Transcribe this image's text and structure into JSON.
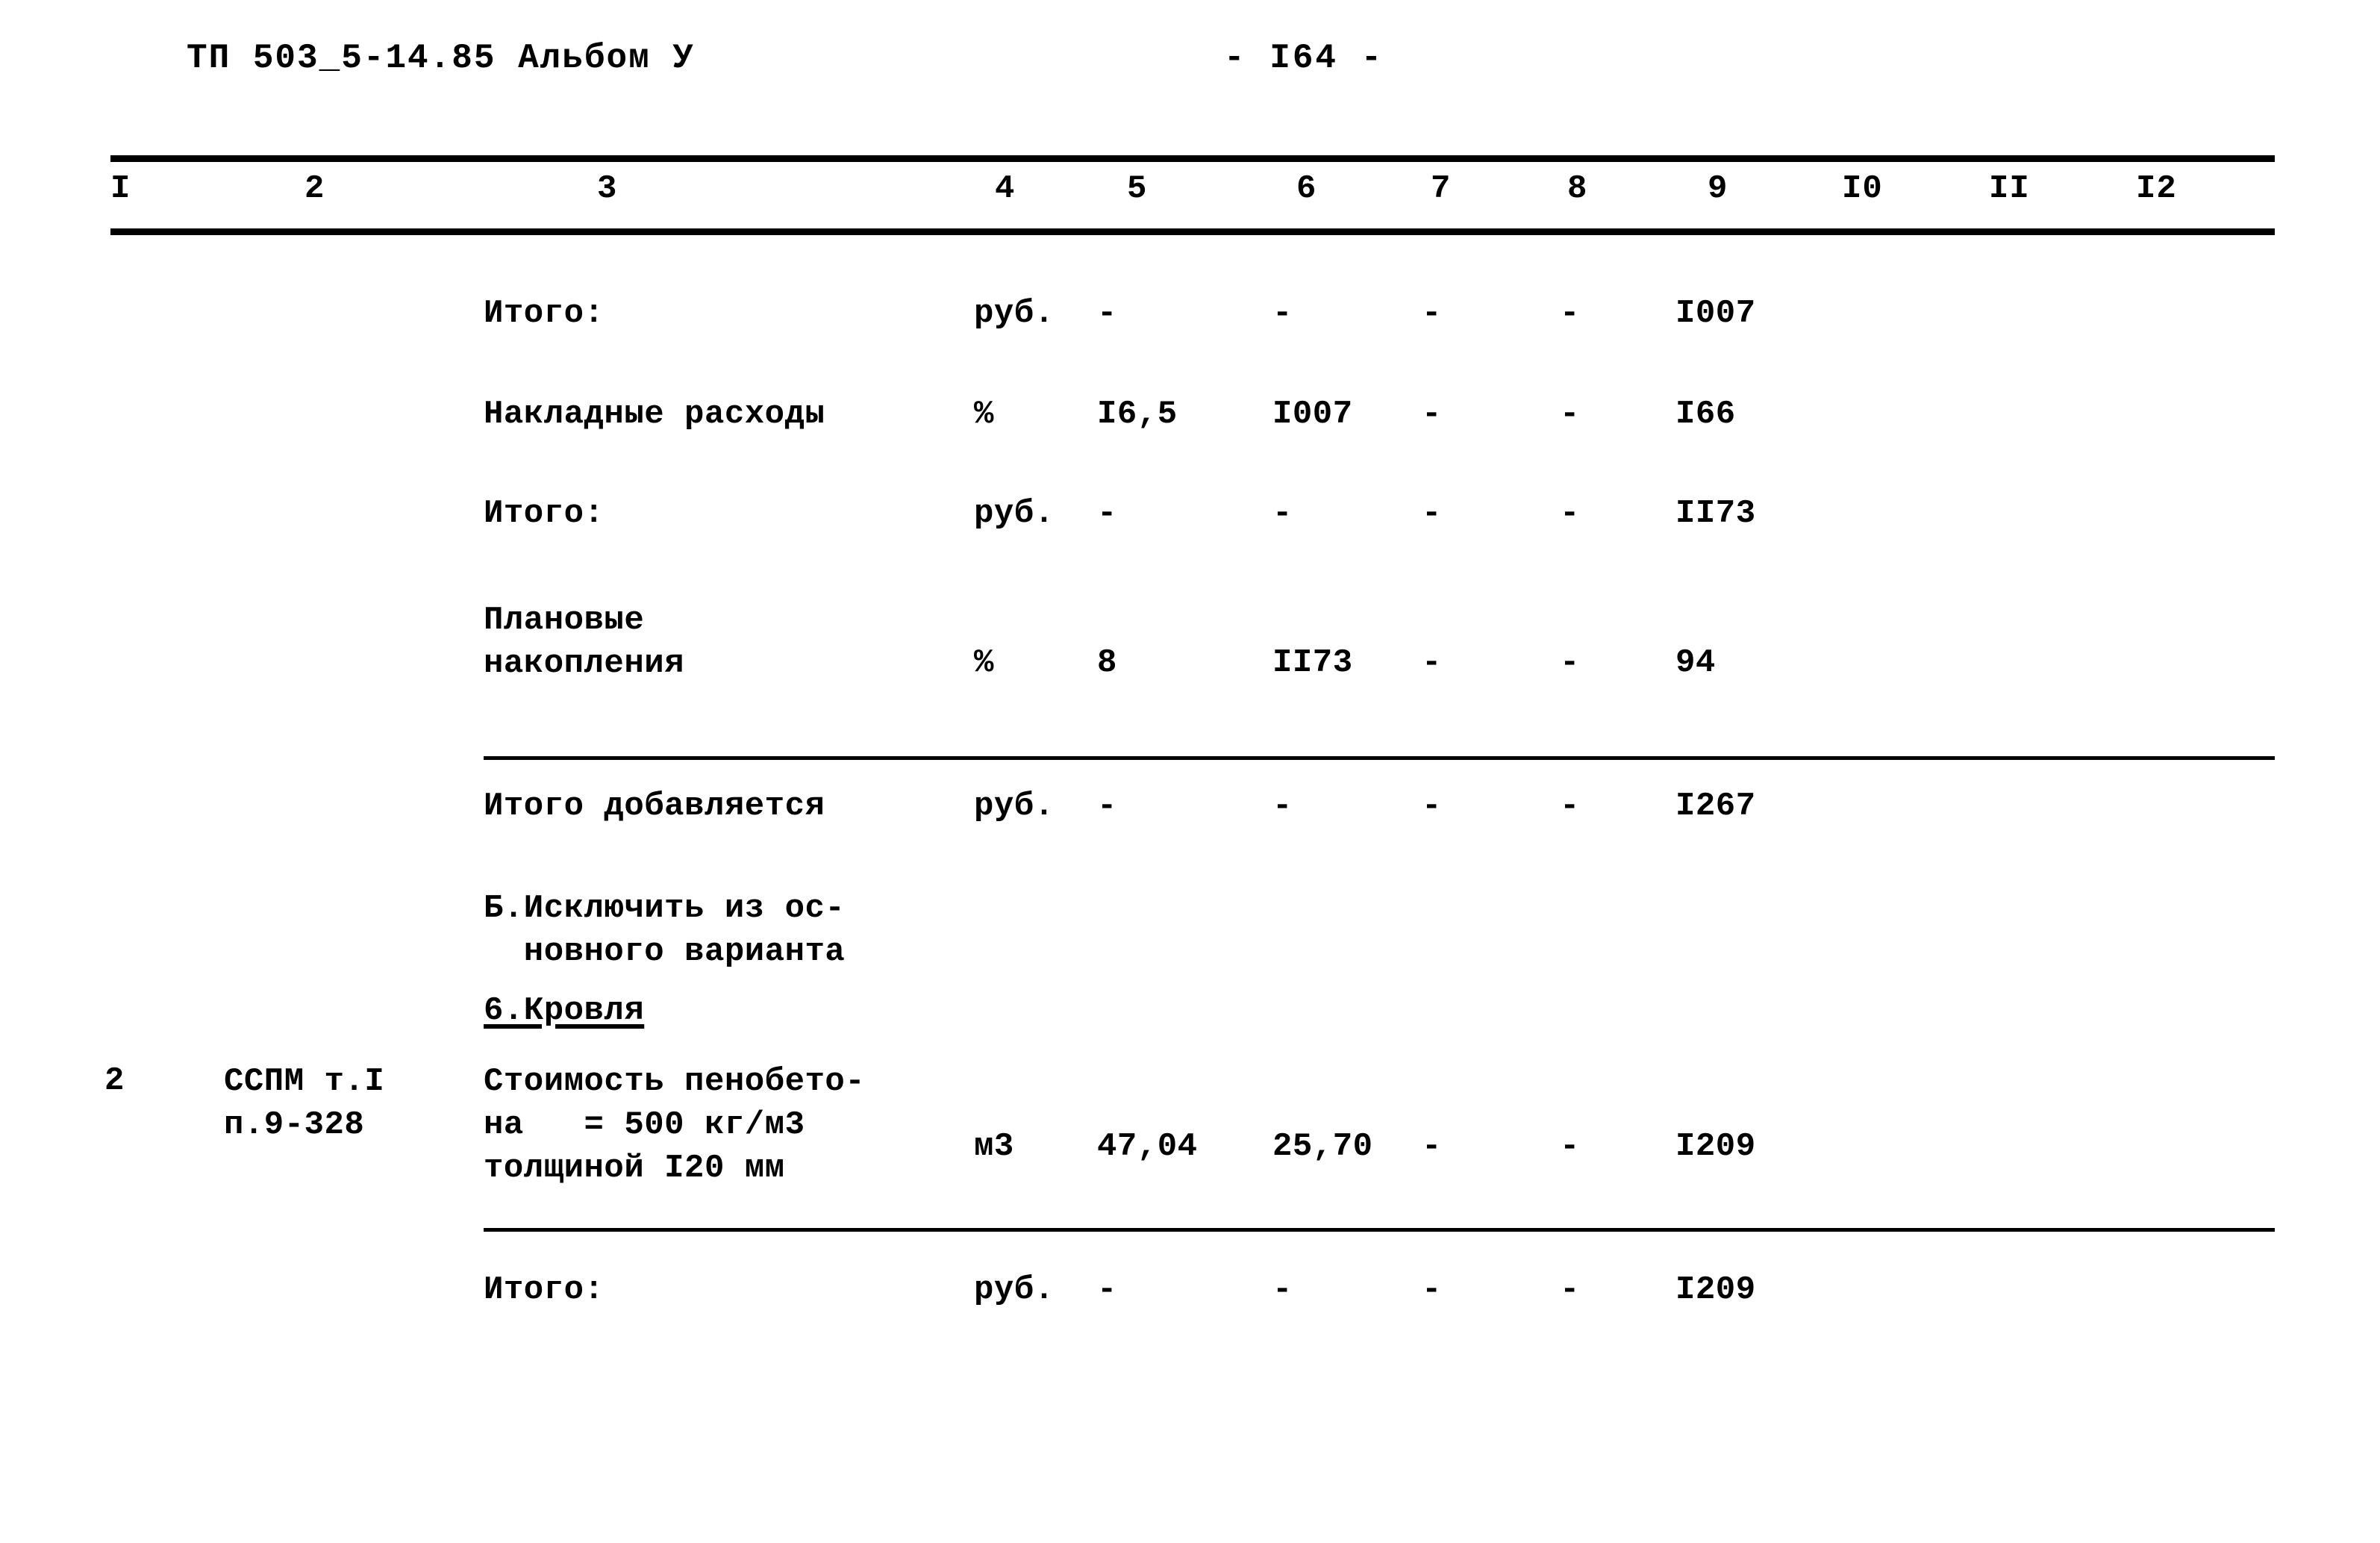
{
  "header": {
    "doc_code": "ТП 503_5-14.85 Альбом У",
    "page_number": "- I64 -"
  },
  "table": {
    "column_headers": [
      "I",
      "2",
      "3",
      "4",
      "5",
      "6",
      "7",
      "8",
      "9",
      "I0",
      "II",
      "I2"
    ],
    "rows": [
      {
        "id": "itogo-1",
        "c1": "",
        "c2": "",
        "c3": "Итого:",
        "c4": "руб.",
        "c5": "-",
        "c6": "-",
        "c7": "-",
        "c8": "-",
        "c9": "I007"
      },
      {
        "id": "nakladnye-rashody",
        "c1": "",
        "c2": "",
        "c3": "Накладные расходы",
        "c4": "%",
        "c5": "I6,5",
        "c6": "I007",
        "c7": "-",
        "c8": "-",
        "c9": "I66"
      },
      {
        "id": "itogo-2",
        "c1": "",
        "c2": "",
        "c3": "Итого:",
        "c4": "руб.",
        "c5": "-",
        "c6": "-",
        "c7": "-",
        "c8": "-",
        "c9": "II73"
      },
      {
        "id": "planovye-nakopleniya",
        "c1": "",
        "c2": "",
        "c3": "Плановые\nнакопления",
        "c4": "%",
        "c5": "8",
        "c6": "II73",
        "c7": "-",
        "c8": "-",
        "c9": "94"
      },
      {
        "id": "itogo-dobavlyaetsya",
        "c1": "",
        "c2": "",
        "c3": "Итого добавляется",
        "c4": "руб.",
        "c5": "-",
        "c6": "-",
        "c7": "-",
        "c8": "-",
        "c9": "I267"
      },
      {
        "id": "section-b",
        "c1": "",
        "c2": "",
        "c3": "Б.Исключить из ос-\n  новного варианта",
        "c4": "",
        "c5": "",
        "c6": "",
        "c7": "",
        "c8": "",
        "c9": ""
      },
      {
        "id": "subsection-krovlya",
        "c1": "",
        "c2": "",
        "c3": "6.Кровля",
        "c4": "",
        "c5": "",
        "c6": "",
        "c7": "",
        "c8": "",
        "c9": ""
      },
      {
        "id": "penobeton",
        "c1": "2",
        "c2": "ССПМ т.I\nп.9-328",
        "c3": "Стоимость пенобето-\nна   = 500 кг/м3\nтолщиной I20 мм",
        "c4": "м3",
        "c5": "47,04",
        "c6": "25,70",
        "c7": "-",
        "c8": "-",
        "c9": "I209"
      },
      {
        "id": "itogo-3",
        "c1": "",
        "c2": "",
        "c3": "Итого:",
        "c4": "руб.",
        "c5": "-",
        "c6": "-",
        "c7": "-",
        "c8": "-",
        "c9": "I209"
      }
    ]
  }
}
